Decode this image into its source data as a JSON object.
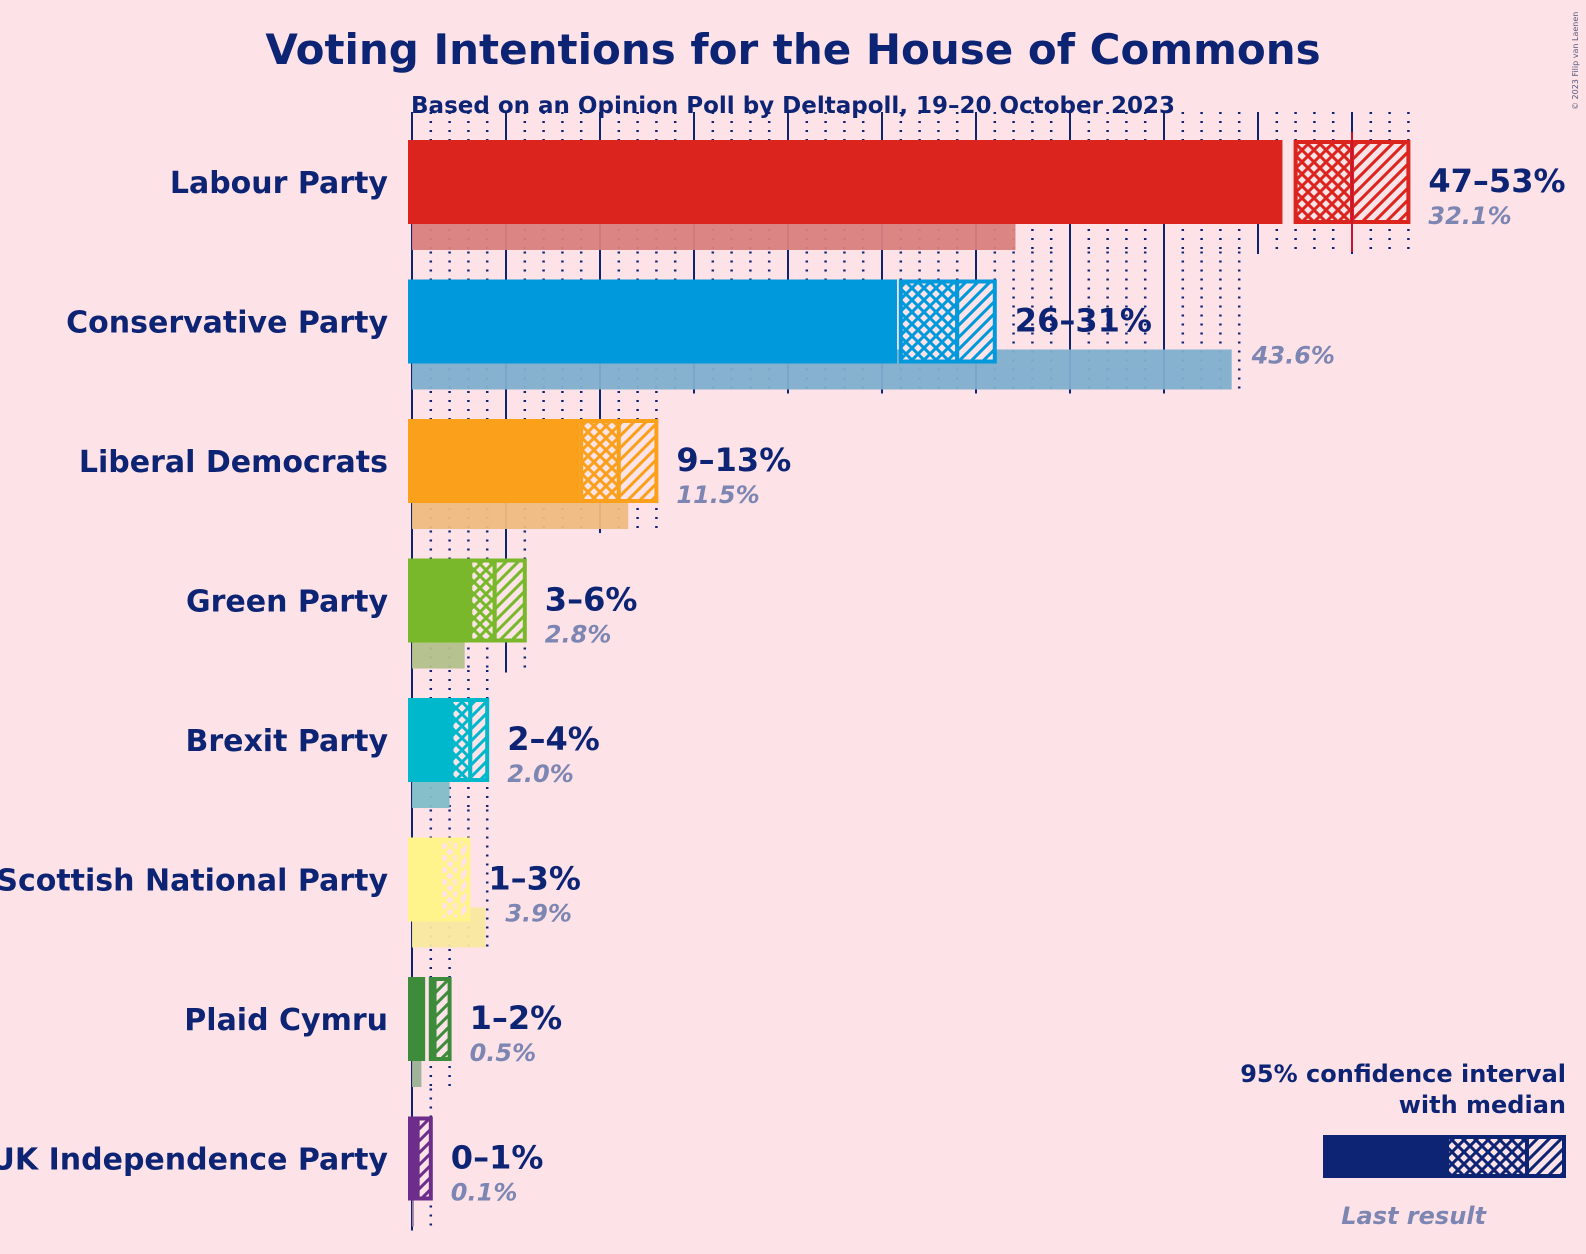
{
  "chart_data": {
    "type": "bar",
    "orientation": "horizontal",
    "title": "Voting Intentions for the House of Commons",
    "subtitle": "Based on an Opinion Poll by Deltapoll, 19–20 October 2023",
    "copyright": "© 2023 Filip van Laenen",
    "xlabel": "",
    "ylabel": "",
    "xlim": [
      0,
      55
    ],
    "grid": {
      "major_every": 5,
      "minor_every": 1
    },
    "majority_line": 50,
    "categories": [
      "Labour Party",
      "Conservative Party",
      "Liberal Democrats",
      "Green Party",
      "Brexit Party",
      "Scottish National Party",
      "Plaid Cymru",
      "UK Independence Party"
    ],
    "series": [
      {
        "name": "95% confidence interval with median",
        "parties": [
          {
            "party": "Labour Party",
            "color": "#dc241f",
            "ci_low": 47,
            "median": 50,
            "ci_high": 53,
            "solid_to": 46.3,
            "range_label": "47–53%"
          },
          {
            "party": "Conservative Party",
            "color": "#0099db",
            "ci_low": 26,
            "median": 29,
            "ci_high": 31,
            "solid_to": 25.8,
            "range_label": "26–31%"
          },
          {
            "party": "Liberal Democrats",
            "color": "#faa01a",
            "ci_low": 9,
            "median": 11,
            "ci_high": 13,
            "solid_to": 8.9,
            "range_label": "9–13%"
          },
          {
            "party": "Green Party",
            "color": "#78b82a",
            "ci_low": 3,
            "median": 4.4,
            "ci_high": 6,
            "solid_to": 3.1,
            "range_label": "3–6%"
          },
          {
            "party": "Brexit Party",
            "color": "#00b8cc",
            "ci_low": 2,
            "median": 3.1,
            "ci_high": 4,
            "solid_to": 2.1,
            "range_label": "2–4%"
          },
          {
            "party": "Scottish National Party",
            "color": "#fff48c",
            "ci_low": 1,
            "median": 2.5,
            "ci_high": 3,
            "solid_to": 1.5,
            "range_label": "1–3%"
          },
          {
            "party": "Plaid Cymru",
            "color": "#3c8c3c",
            "ci_low": 1,
            "median": 1.2,
            "ci_high": 2,
            "solid_to": 0.7,
            "range_label": "1–2%"
          },
          {
            "party": "UK Independence Party",
            "color": "#6d2d8a",
            "ci_low": 0,
            "median": 0.3,
            "ci_high": 1,
            "solid_to": 0.1,
            "range_label": "0–1%"
          }
        ]
      },
      {
        "name": "Last result",
        "values": [
          32.1,
          43.6,
          11.5,
          2.8,
          2.0,
          3.9,
          0.5,
          0.1
        ],
        "labels": [
          "32.1%",
          "43.6%",
          "11.5%",
          "2.8%",
          "2.0%",
          "3.9%",
          "0.5%",
          "0.1%"
        ],
        "colors": [
          "#d98080",
          "#7fafcf",
          "#eebb80",
          "#b2c08a",
          "#80bcc8",
          "#f8e8a0",
          "#9cb094",
          "#a084ac"
        ]
      }
    ],
    "legend": {
      "position": "bottom-right",
      "ci_label_line1": "95% confidence interval",
      "ci_label_line2": "with median",
      "last_result_label": "Last result",
      "ci_color": "#0d2474",
      "last_result_color": "#8082a0"
    }
  },
  "colors": {
    "background": "#fde3e7",
    "text": "#0d2474",
    "last_text": "#7d86b2",
    "grid": "#0d2474"
  }
}
